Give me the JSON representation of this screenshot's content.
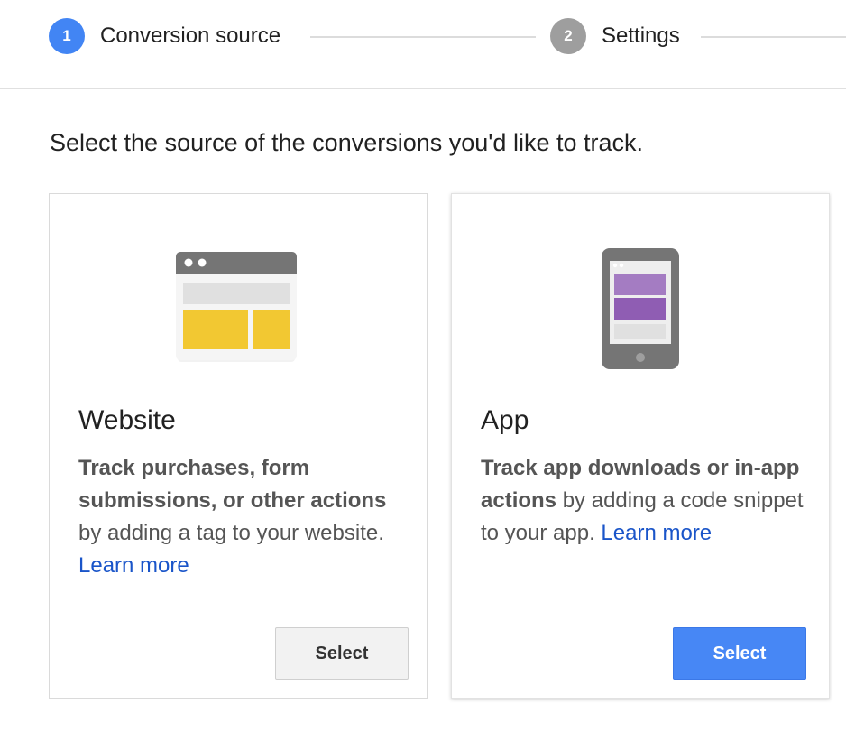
{
  "stepper": {
    "steps": [
      {
        "number": "1",
        "label": "Conversion source",
        "state": "active"
      },
      {
        "number": "2",
        "label": "Settings",
        "state": "inactive"
      }
    ]
  },
  "instruction": "Select the source of the conversions you'd like to track.",
  "cards": {
    "website": {
      "icon": "browser-window-icon",
      "title": "Website",
      "desc_bold": "Track purchases, form submissions, or other actions",
      "desc_rest": " by adding a tag to your website. ",
      "link": "Learn more",
      "button": "Select"
    },
    "app": {
      "icon": "mobile-phone-icon",
      "title": "App",
      "desc_bold": "Track app downloads or in-app actions",
      "desc_rest": " by adding a code snippet to your app. ",
      "link": "Learn more",
      "button": "Select"
    }
  },
  "colors": {
    "accent": "#4285f4",
    "inactive_step": "#9e9e9e",
    "link": "#1a55c9",
    "website_yellow": "#f2c832",
    "app_purple": "#a47cc2"
  }
}
